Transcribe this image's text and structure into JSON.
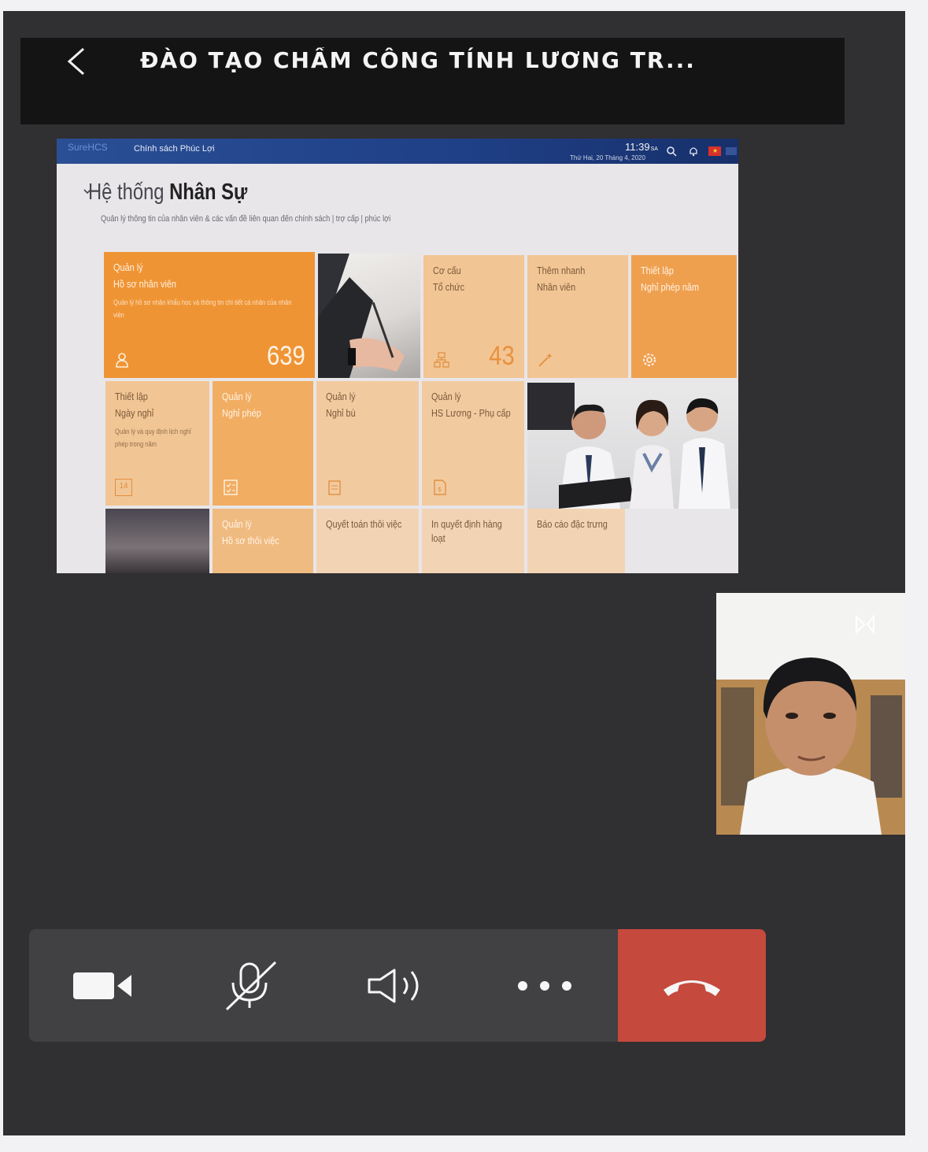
{
  "meeting": {
    "title": "ĐÀO TẠO CHẤM CÔNG TÍNH LƯƠNG TR..."
  },
  "shared_screen": {
    "header": {
      "logo": "SureHCS",
      "menu_label": "Chính sách Phúc Lợi",
      "time": "11:39",
      "time_suffix": "SA",
      "date": "Thứ Hai, 20 Tháng 4, 2020"
    },
    "section": {
      "title_light": "Hệ thống ",
      "title_bold": "Nhân Sự",
      "subtitle": "Quản lý thông tin của nhân viên & các vấn đề liên quan đến chính sách | trợ cấp | phúc lợi"
    },
    "tiles": {
      "employee_records": {
        "line1": "Quản lý",
        "line2": "Hồ sơ nhân viên",
        "desc": "Quản lý hồ sơ nhân khẩu học và thông tin chi tiết cá nhân của nhân viên",
        "count": "639"
      },
      "org_structure": {
        "line1": "Cơ cấu",
        "line2": "Tổ chức",
        "count": "43"
      },
      "quick_add": {
        "line1": "Thêm nhanh",
        "line2": "Nhân viên"
      },
      "annual_leave_setup": {
        "line1": "Thiết lập",
        "line2": "Nghỉ phép năm"
      },
      "holiday_setup": {
        "line1": "Thiết lập",
        "line2": "Ngày nghỉ",
        "desc": "Quản lý và quy định lịch nghỉ phép trong năm",
        "icon_text": "14"
      },
      "leave_mgmt": {
        "line1": "Quản lý",
        "line2": "Nghỉ phép"
      },
      "comp_leave_mgmt": {
        "line1": "Quản lý",
        "line2": "Nghỉ bù"
      },
      "salary_mgmt": {
        "line1": "Quản lý",
        "line2": "HS Lương - Phụ cấp"
      },
      "resignation_records": {
        "line1": "Quản lý",
        "line2": "Hồ sơ thôi việc"
      },
      "resignation_settlement": {
        "line1": "Quyết toán thôi việc"
      },
      "bulk_decisions": {
        "line1": "In quyết định hàng",
        "line2": "loạt"
      },
      "special_reports": {
        "line1": "Báo cáo đặc trưng"
      }
    }
  },
  "icons": {
    "back": "chevron-left-icon",
    "camera": "video-camera-icon",
    "mic": "microphone-muted-icon",
    "speaker": "speaker-icon",
    "more": "more-options-icon",
    "hangup": "end-call-icon"
  },
  "colors": {
    "window_bg": "#302f31",
    "title_bar": "#141414",
    "control_bar": "#414042",
    "hangup": "#c5493d",
    "tile_dark": "#ef9434",
    "tile_light": "#f2c594",
    "app_header": "#2a4f95"
  }
}
